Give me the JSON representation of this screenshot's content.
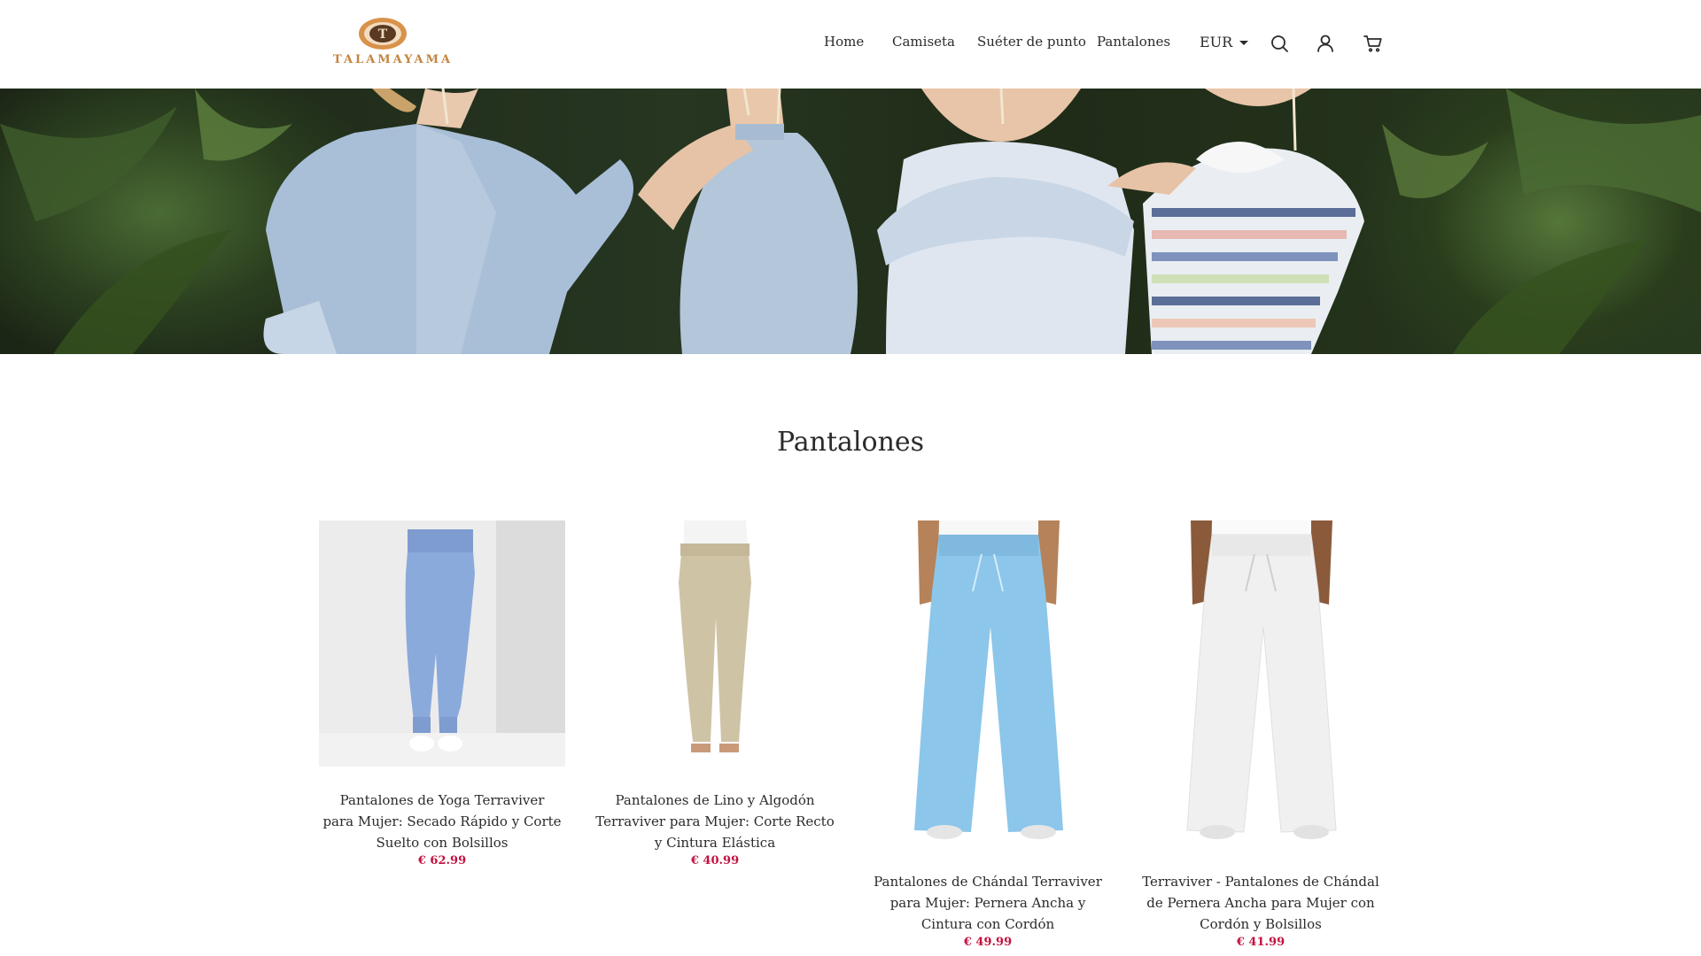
{
  "header": {
    "logo_text": "TALAMAYAMA",
    "logo_letter": "T",
    "nav": [
      {
        "label": "Home"
      },
      {
        "label": "Camiseta"
      },
      {
        "label": "Suéter de punto"
      },
      {
        "label": "Pantalones"
      }
    ],
    "currency": "EUR",
    "icons": [
      "search-icon",
      "account-icon",
      "cart-icon"
    ]
  },
  "hero": {
    "image": "banner-photo-four-women"
  },
  "collection": {
    "title": "Pantalones",
    "products": [
      {
        "title": "Pantalones de Yoga Terraviver para Mujer: Secado Rápido y Corte Suelto con Bolsillos",
        "price": "€ 62.99",
        "color": "#8aaadb"
      },
      {
        "title": "Pantalones de Lino y Algodón Terraviver para Mujer: Corte Recto y Cintura Elástica",
        "price": "€ 40.99",
        "color": "#cfc3a6"
      },
      {
        "title": "Pantalones de Chándal Terraviver para Mujer: Pernera Ancha y Cintura con Cordón",
        "price": "€ 49.99",
        "color": "#8cc6ea"
      },
      {
        "title": "Terraviver - Pantalones de Chándal de Pernera Ancha para Mujer con Cordón y Bolsillos",
        "price": "€ 41.99",
        "color": "#f2f2f2"
      }
    ]
  },
  "colors": {
    "price": "#c2123f",
    "logo": "#c4843e",
    "text": "#2b2b2b"
  }
}
